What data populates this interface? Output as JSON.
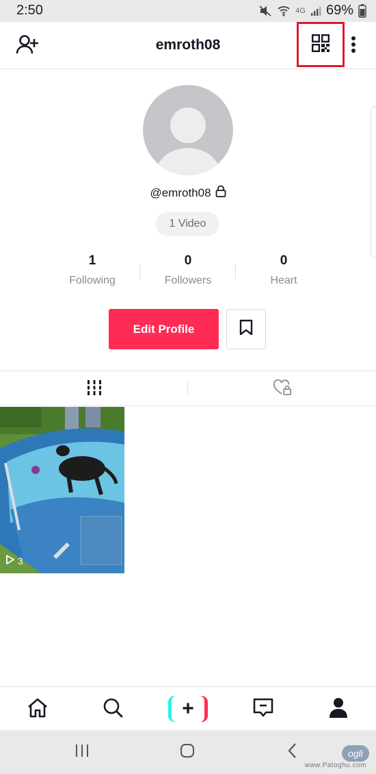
{
  "status_bar": {
    "time": "2:50",
    "network": "4G",
    "battery_percent": "69%"
  },
  "header": {
    "title": "emroth08",
    "icons": [
      "add-user-icon",
      "qr-code-icon",
      "more-vertical-icon"
    ],
    "highlight_color": "#e0182c"
  },
  "profile": {
    "handle": "@emroth08",
    "private_icon": "lock-icon",
    "video_count": "1 Video"
  },
  "stats": [
    {
      "value": "1",
      "label": "Following"
    },
    {
      "value": "0",
      "label": "Followers"
    },
    {
      "value": "0",
      "label": "Heart"
    }
  ],
  "actions": {
    "edit_profile": "Edit Profile",
    "edit_color": "#fe2c55",
    "bookmark_icon": "bookmark-icon"
  },
  "tabs": [
    {
      "icon": "grid-icon",
      "active": true
    },
    {
      "icon": "liked-private-icon",
      "active": false
    }
  ],
  "videos": [
    {
      "plays": "3",
      "thumbnail": "dog swimming in pool"
    }
  ],
  "bottom_nav": [
    "home-icon",
    "search-icon",
    "create-icon",
    "inbox-icon",
    "profile-icon"
  ],
  "create_colors": {
    "left": "#25f4ee",
    "right": "#fe2c55"
  },
  "system_nav": [
    "recents-icon",
    "home-icon",
    "back-icon"
  ],
  "watermark": "www.Patoghu.com",
  "watermark_logo": "ogli"
}
